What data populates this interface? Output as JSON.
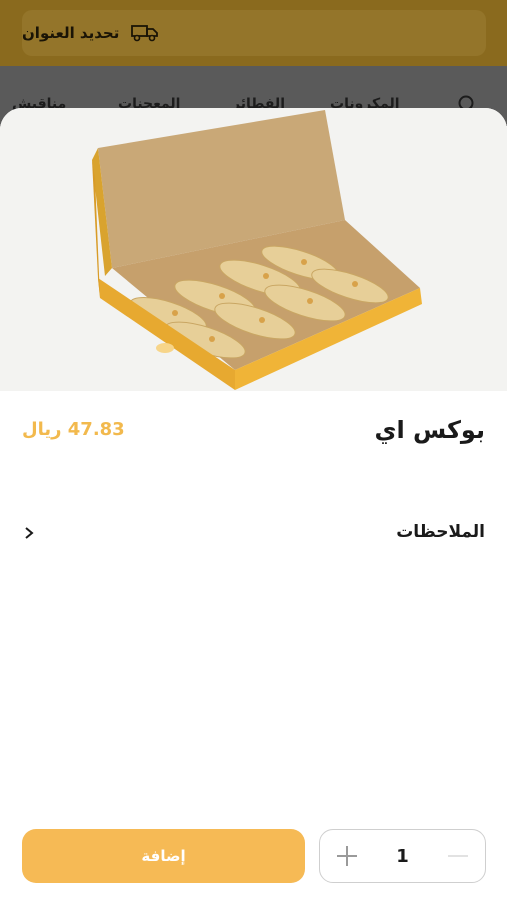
{
  "background": {
    "address_label": "تحديد العنوان",
    "nav_items": [
      "مناقيش",
      "المعجنات",
      "الفطائر",
      "المكرونات"
    ]
  },
  "product": {
    "name": "بوكس اي",
    "price": "47.83 ريال",
    "image_alt": "box of wraps"
  },
  "notes": {
    "label": "الملاحظات"
  },
  "footer": {
    "add_label": "إضافة",
    "quantity": "1"
  },
  "colors": {
    "accent": "#f6ba55",
    "price": "#f2b94d"
  },
  "icons": [
    "truck-icon",
    "search-icon",
    "chevron-right-icon",
    "plus-icon",
    "minus-icon"
  ]
}
